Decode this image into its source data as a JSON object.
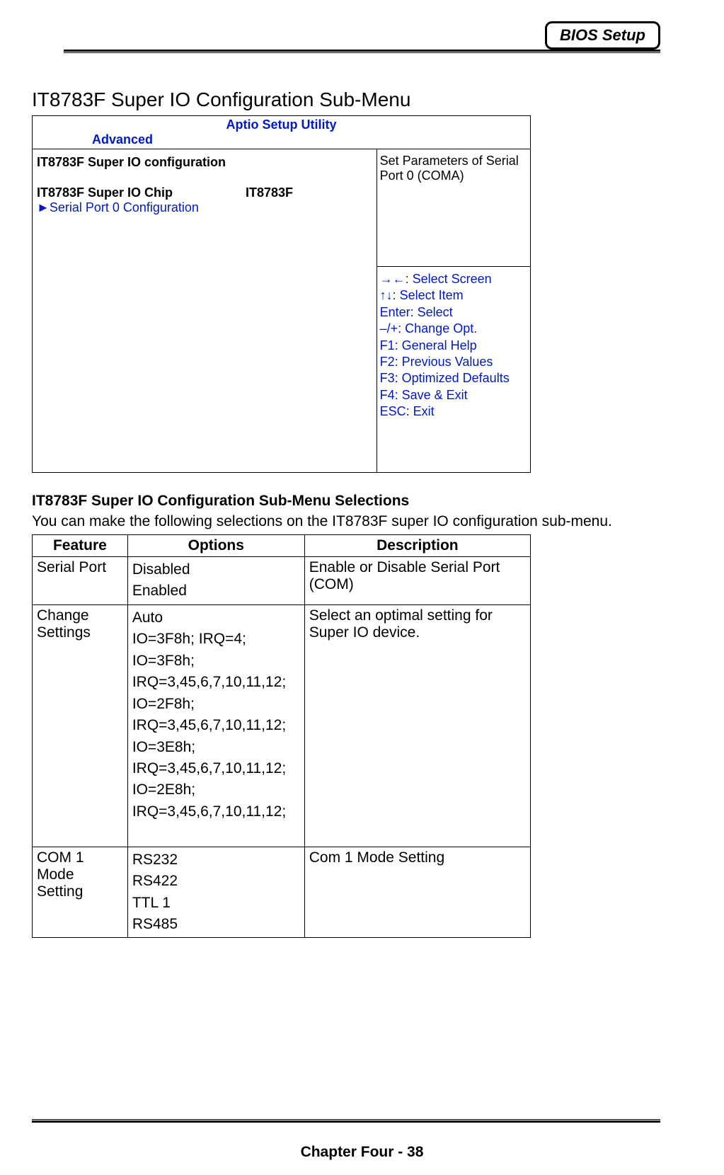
{
  "header": {
    "badge": "BIOS Setup"
  },
  "title": "IT8783F Super IO Configuration Sub-Menu",
  "bios": {
    "utility": "Aptio Setup Utility",
    "tab": "Advanced",
    "config_title": "IT8783F Super IO configuration",
    "chip_label": "IT8783F Super IO Chip",
    "chip_value": "IT8783F",
    "submenu_arrow": "►",
    "submenu_label": "Serial Port 0 Configuration",
    "help_text": "Set Parameters of Serial Port 0 (COMA)",
    "nav": {
      "l0": "→←: Select Screen",
      "l1": "↑↓: Select Item",
      "l2": "Enter: Select",
      "l3": "–/+: Change Opt.",
      "l4": "F1: General Help",
      "l5": "F2: Previous Values",
      "l6": "F3: Optimized Defaults",
      "l7": "F4: Save & Exit",
      "l8": "ESC: Exit"
    }
  },
  "section": {
    "heading": "IT8783F Super IO Configuration Sub-Menu Selections",
    "intro": "You can make the following selections on the IT8783F super IO configuration sub-menu."
  },
  "table": {
    "headers": {
      "feature": "Feature",
      "options": "Options",
      "description": "Description"
    },
    "rows": {
      "r0": {
        "feature": "Serial Port",
        "opt0": "Disabled",
        "opt1": "Enabled",
        "description": "Enable or Disable Serial Port (COM)"
      },
      "r1": {
        "feature": "Change Settings",
        "opt0": "Auto",
        "opt1": "IO=3F8h; IRQ=4;",
        "opt2": "IO=3F8h;",
        "opt3": "IRQ=3,45,6,7,10,11,12;",
        "opt4": "IO=2F8h;",
        "opt5": "IRQ=3,45,6,7,10,11,12;",
        "opt6": "IO=3E8h;",
        "opt7": "IRQ=3,45,6,7,10,11,12;",
        "opt8": "IO=2E8h;",
        "opt9": "IRQ=3,45,6,7,10,11,12;",
        "description": "Select an optimal setting for Super IO device."
      },
      "r2": {
        "feature": "COM 1 Mode Setting",
        "opt0": "RS232",
        "opt1": "RS422",
        "opt2": "TTL 1",
        "opt3": "RS485",
        "description": "Com 1 Mode Setting"
      }
    }
  },
  "footer": {
    "text": "Chapter Four - 38"
  }
}
